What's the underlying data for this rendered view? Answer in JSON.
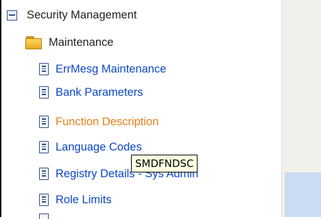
{
  "tree": {
    "root": {
      "label": "Security Management",
      "icon": "collapse-icon"
    },
    "folder": {
      "label": "Maintenance",
      "icon": "folder-open-icon"
    },
    "items": [
      {
        "label": "ErrMesg Maintenance",
        "icon": "document-icon"
      },
      {
        "label": "Bank Parameters",
        "icon": "document-icon"
      },
      {
        "label": "Function Description",
        "icon": "document-icon",
        "state": "hover"
      },
      {
        "label": "Language Codes",
        "icon": "document-icon"
      },
      {
        "label": "Registry Details - Sys Admin",
        "icon": "document-icon"
      },
      {
        "label": "Role Limits",
        "icon": "document-icon"
      }
    ]
  },
  "tooltip": {
    "text": "SMDFNDSC"
  },
  "colors": {
    "link": "#0b47c7",
    "hover": "#e5801a",
    "panel": "#f1f1ec",
    "accent": "#c9dcf2"
  }
}
